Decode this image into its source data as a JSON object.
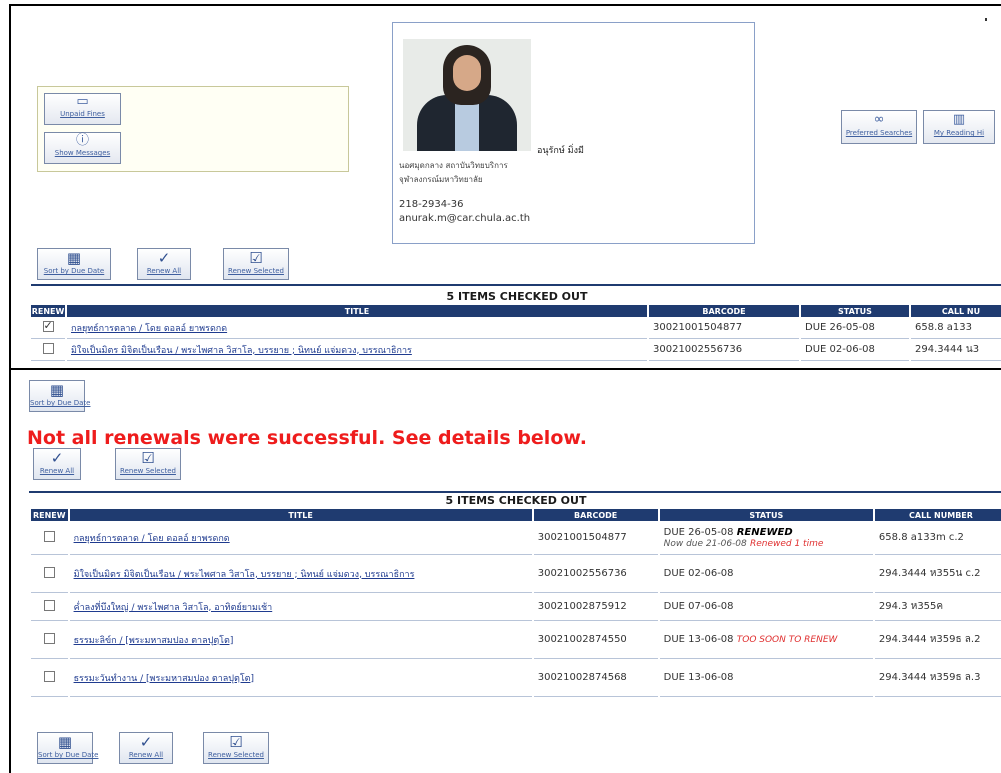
{
  "top": {
    "quick_buttons": {
      "unpaid_fines": "Unpaid Fines",
      "show_messages": "Show Messages"
    },
    "profile": {
      "name": "อนุรักษ์ มิ่งมี",
      "line1": "นอศมุดกลาง สถาบันวิทยบริการ",
      "line2": "จุฬาลงกรณ์มหาวิทยาลัย",
      "phone": "218-2934-36",
      "email": "anurak.m@car.chula.ac.th"
    },
    "right_buttons": {
      "preferred_searches": "Preferred Searches",
      "my_reading": "My Reading Hi"
    },
    "actions": {
      "sort_by_due_date": "Sort by Due Date",
      "renew_all": "Renew All",
      "renew_selected": "Renew Selected"
    },
    "table_title": "5 ITEMS CHECKED OUT",
    "headers": [
      "RENEW",
      "TITLE",
      "BARCODE",
      "STATUS",
      "CALL NU"
    ],
    "rows": [
      {
        "checked": true,
        "title": "กลยุทธ์การตลาด / โดย ดอลอ์ ยาพรดกด",
        "barcode": "30021001504877",
        "status": "DUE 26-05-08",
        "call": "658.8 a133"
      },
      {
        "checked": false,
        "title": "มิใจเป็นมิตร มิจิตเป็นเรือน / พระไพศาล วิสาโล, บรรยาย ; นิทนย์ แจ่มดวง, บรรณาธิการ",
        "barcode": "30021002556736",
        "status": "DUE 02-06-08",
        "call": "294.3444 น3"
      }
    ]
  },
  "bottom": {
    "actions": {
      "sort_by_due_date": "Sort by Due Date",
      "renew_all": "Renew All",
      "renew_selected": "Renew Selected"
    },
    "error_message": "Not all renewals were successful. See details below.",
    "table_title": "5 ITEMS CHECKED OUT",
    "headers": [
      "RENEW",
      "TITLE",
      "BARCODE",
      "STATUS",
      "CALL NUMBER"
    ],
    "rows": [
      {
        "title": "กลยุทธ์การตลาด / โดย ดอลอ์ ยาพรดกด",
        "barcode": "30021001504877",
        "status_main": "DUE 26-05-08",
        "status_flag": "RENEWED",
        "status_note": "Now due 21-06-08",
        "status_extra": "Renewed 1 time",
        "call": "658.8 a133m c.2"
      },
      {
        "title": "มิใจเป็นมิตร มิจิตเป็นเรือน / พระไพศาล วิสาโล, บรรยาย ; นิทนย์ แจ่มดวง, บรรณาธิการ",
        "barcode": "30021002556736",
        "status_main": "DUE 02-06-08",
        "status_flag": "",
        "status_note": "",
        "status_extra": "",
        "call": "294.3444 ห355น c.2"
      },
      {
        "title": "ค่ำลงที่บึงใหญ่ / พระไพศาล วิสาโล, อาทิตย์ยามเช้า",
        "barcode": "30021002875912",
        "status_main": "DUE 07-06-08",
        "status_flag": "",
        "status_note": "",
        "status_extra": "",
        "call": "294.3 ห355ค"
      },
      {
        "title": "ธรรมะลิข์ก / [พระมหาสมปอง ตาลปุตฺโต]",
        "barcode": "30021002874550",
        "status_main": "DUE 13-06-08",
        "status_flag": "",
        "status_note": "",
        "status_extra": "TOO SOON TO RENEW",
        "call": "294.3444 ห359ธ ล.2"
      },
      {
        "title": "ธรรมะวันทำงาน / [พระมหาสมปอง ตาลปุตฺโต]",
        "barcode": "30021002874568",
        "status_main": "DUE 13-06-08",
        "status_flag": "",
        "status_note": "",
        "status_extra": "",
        "call": "294.3444 ห359ธ ล.3"
      }
    ]
  },
  "icons": {
    "fines": "computer-icon",
    "messages": "info-icon",
    "preferred": "binoculars-icon",
    "reading": "books-icon",
    "sort": "calendar-icon",
    "renew_all": "check-icon",
    "renew_selected": "check-list-icon"
  },
  "colors": {
    "header_bg": "#1f3b70",
    "error": "#ee1c1c",
    "link": "#1f3b8f"
  }
}
